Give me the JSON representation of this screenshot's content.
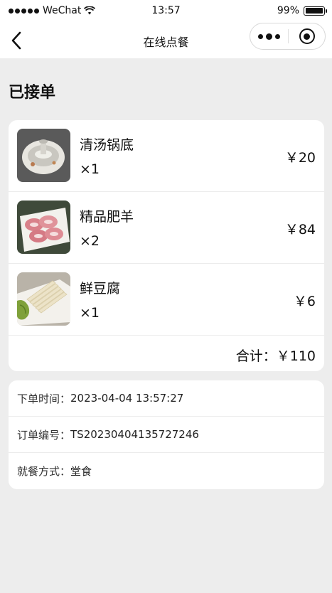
{
  "status_bar": {
    "carrier": "WeChat",
    "time": "13:57",
    "battery": "99%",
    "battery_level": 0.99
  },
  "nav": {
    "title": "在线点餐"
  },
  "order": {
    "status": "已接单",
    "items": [
      {
        "name": "清汤锅底",
        "qty": "×1",
        "price": "￥20",
        "icon": "hotpot-icon"
      },
      {
        "name": "精品肥羊",
        "qty": "×2",
        "price": "￥84",
        "icon": "lamb-slices-icon"
      },
      {
        "name": "鲜豆腐",
        "qty": "×1",
        "price": "￥6",
        "icon": "tofu-icon"
      }
    ],
    "total_label": "合计：",
    "total_value": "￥110"
  },
  "info": {
    "order_time_label": "下单时间：",
    "order_time": "2023-04-04 13:57:27",
    "order_no_label": "订单编号：",
    "order_no": "TS20230404135727246",
    "dining_label": "就餐方式：",
    "dining": "堂食"
  }
}
